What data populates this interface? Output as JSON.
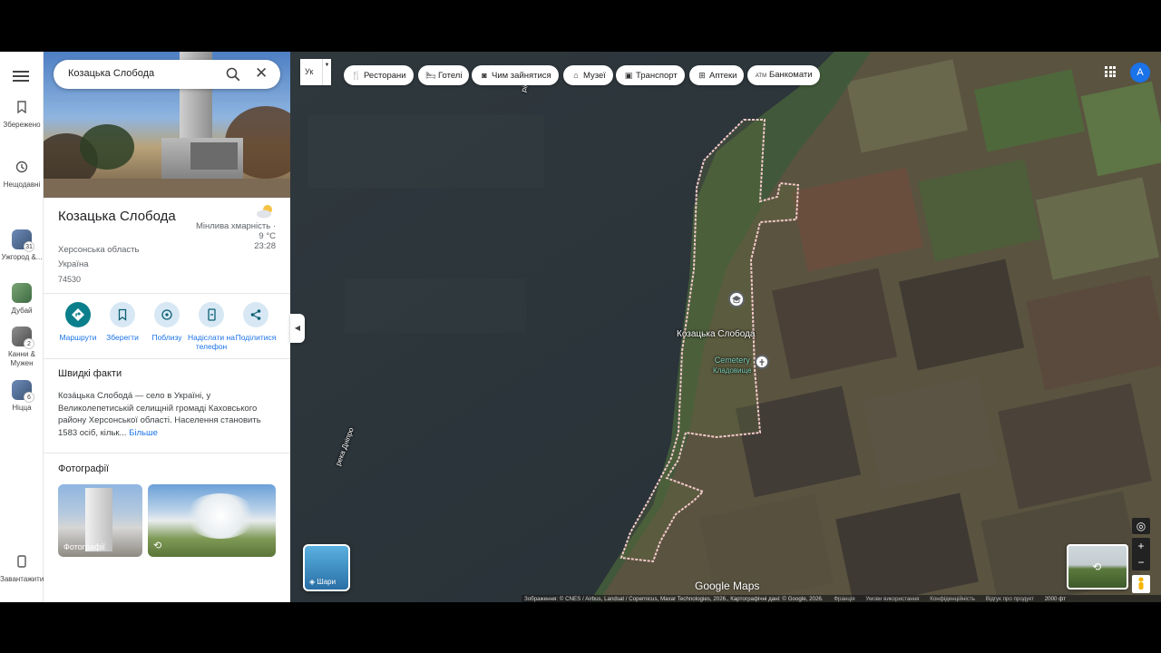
{
  "search": {
    "query": "Козацька Слобода"
  },
  "rail": {
    "items": [
      {
        "label": "Збережено",
        "icon": "bookmark-icon"
      },
      {
        "label": "Нещодавні",
        "icon": "history-icon"
      },
      {
        "label": "Ужгород &...",
        "badge": "31"
      },
      {
        "label": "Дубай",
        "badge": ""
      },
      {
        "label": "Канни & Мужен",
        "badge": "2"
      },
      {
        "label": "Ніцца",
        "badge": "6"
      }
    ],
    "download_label": "Завантажити..."
  },
  "place": {
    "name": "Козацька Слобода",
    "region": "Херсонська область",
    "country": "Україна",
    "postcode": "74530",
    "weather": {
      "condition": "Мінлива хмарність ·",
      "temp": "9 °C",
      "time": "23:28",
      "icon": "partly-cloudy-icon"
    }
  },
  "actions": [
    {
      "label": "Маршрути",
      "icon": "directions-icon"
    },
    {
      "label": "Зберегти",
      "icon": "bookmark-icon"
    },
    {
      "label": "Поблизу",
      "icon": "nearby-icon"
    },
    {
      "label": "Надіслати на телефон",
      "icon": "send-to-phone-icon"
    },
    {
      "label": "Поділитися",
      "icon": "share-icon"
    }
  ],
  "facts": {
    "heading": "Швидкі факти",
    "text": "Коза́цька Слобода́ — село в Україні, у Великолепетиській селищній громаді Каховського району Херсонської області. Населення становить 1583 осіб, кільк...",
    "more": "Більше"
  },
  "photos": {
    "heading": "Фотографії",
    "first_label": "Фотографії"
  },
  "map": {
    "lang": "Ук",
    "chips": [
      "Ресторани",
      "Готелі",
      "Чим зайнятися",
      "Музеї",
      "Транспорт",
      "Аптеки",
      "Банкомати"
    ],
    "avatar": "A",
    "layers_label": "Шари",
    "labels": {
      "village": "Козацька Слобода",
      "cemetery": "Cemetery",
      "cemetery_local": "Кладовище",
      "river": "река Дніпро",
      "river_top": "ріка"
    },
    "brand": "Google Maps",
    "attribution": "Зображення: © CNES / Airbus, Landsat / Copernicus, Maxar Technologies, 2026., Картографічні дані: © Google, 2026.",
    "links": [
      "Франція",
      "Умови використання",
      "Конфіденційність",
      "Відгук про продукт"
    ],
    "scale": "2000 фт"
  },
  "colors": {
    "accent": "#1a73e8",
    "primary_action": "#0b7f8c",
    "boundary": "#f3c9c9"
  }
}
